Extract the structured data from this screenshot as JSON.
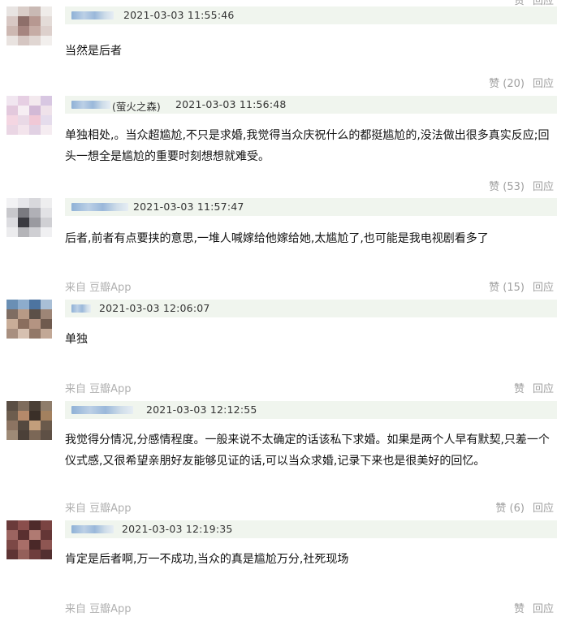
{
  "comments": [
    {
      "username_suffix": "",
      "timestamp": "2021-03-03 11:55:46",
      "content": "当然是后者",
      "source": "",
      "like_label": "赞 (20)",
      "reply_label": "回应"
    },
    {
      "username_suffix": "(萤火之森)",
      "timestamp": "2021-03-03 11:56:48",
      "content": "单独相处,。当众超尴尬,不只是求婚,我觉得当众庆祝什么的都挺尴尬的,没法做出很多真实反应;回头一想全是尴尬的重要时刻想想就难受。",
      "source": "",
      "like_label": "赞 (53)",
      "reply_label": "回应"
    },
    {
      "username_suffix": "",
      "timestamp": "2021-03-03 11:57:47",
      "content": "后者,前者有点要挟的意思,一堆人喊嫁给他嫁给她,太尴尬了,也可能是我电视剧看多了",
      "source": "来自 豆瓣App",
      "like_label": "赞 (15)",
      "reply_label": "回应"
    },
    {
      "username_suffix": "",
      "timestamp": "2021-03-03 12:06:07",
      "content": "单独",
      "source": "来自 豆瓣App",
      "like_label": "赞",
      "reply_label": "回应"
    },
    {
      "username_suffix": "",
      "timestamp": "2021-03-03 12:12:55",
      "content": "我觉得分情况,分感情程度。一般来说不太确定的话该私下求婚。如果是两个人早有默契,只差一个仪式感,又很希望亲朋好友能够见证的话,可以当众求婚,记录下来也是很美好的回忆。",
      "source": "来自 豆瓣App",
      "like_label": "赞 (6)",
      "reply_label": "回应"
    },
    {
      "username_suffix": "",
      "timestamp": "2021-03-03 12:19:35",
      "content": "肯定是后者啊,万一不成功,当众的真是尴尬万分,社死现场",
      "source": "来自 豆瓣App",
      "like_label": "赞",
      "reply_label": "回应"
    }
  ],
  "colors": {
    "meta_bar_bg": "#f0f5ee",
    "action_text": "#a0a0a0",
    "source_text": "#b0b0b0"
  }
}
